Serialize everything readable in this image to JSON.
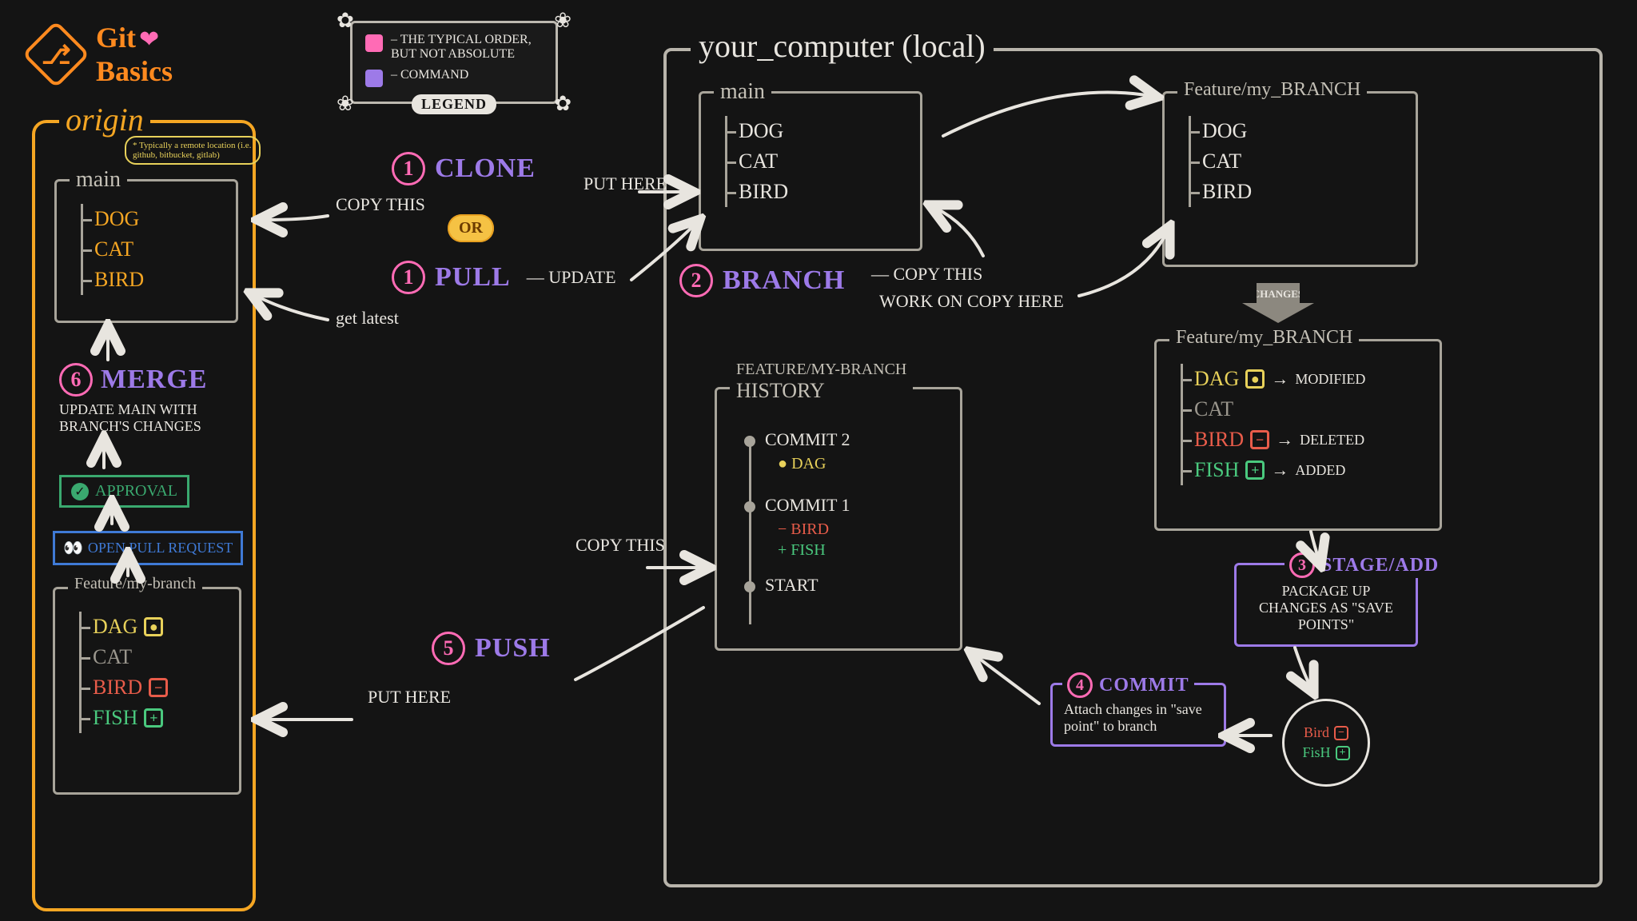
{
  "title": {
    "line1": "Git",
    "line2": "Basics"
  },
  "legend": {
    "label": "LEGEND",
    "pink_desc": "– THE TYPICAL ORDER, BUT NOT ABSOLUTE",
    "purple_desc": "– COMMAND"
  },
  "origin": {
    "title": "origin",
    "note": "* Typically a remote location (i.e. github, bitbucket, gitlab)",
    "main": {
      "title": "main",
      "files": [
        "DOG",
        "CAT",
        "BIRD"
      ]
    },
    "merge": {
      "num": "6",
      "cmd": "MERGE",
      "desc": "UPDATE MAIN WITH BRANCH'S CHANGES"
    },
    "approval": "APPROVAL",
    "pr": "OPEN PULL REQUEST",
    "feature": {
      "title": "Feature/my-branch",
      "files": [
        {
          "name": "DAG",
          "status": "modified"
        },
        {
          "name": "CAT",
          "status": "none"
        },
        {
          "name": "BIRD",
          "status": "deleted"
        },
        {
          "name": "FISH",
          "status": "added"
        }
      ]
    }
  },
  "local": {
    "title": "your_computer (local)",
    "main": {
      "title": "main",
      "files": [
        "DOG",
        "CAT",
        "BIRD"
      ]
    },
    "feature_clean": {
      "title": "Feature/my_BRANCH",
      "files": [
        "DOG",
        "CAT",
        "BIRD"
      ]
    },
    "changes_label": "CHANGES",
    "feature_changed": {
      "title": "Feature/my_BRANCH",
      "files": [
        {
          "name": "DAG",
          "status": "modified",
          "label": "MODIFIED"
        },
        {
          "name": "CAT",
          "status": "none",
          "label": ""
        },
        {
          "name": "BIRD",
          "status": "deleted",
          "label": "DELETED"
        },
        {
          "name": "FISH",
          "status": "added",
          "label": "ADDED"
        }
      ]
    },
    "history": {
      "title": "FEATURE/MY-BRANCH",
      "subtitle": "HISTORY",
      "commits": [
        {
          "label": "COMMIT 2",
          "changes": [
            {
              "sym": "●",
              "text": "DAG",
              "cls": "c-yellow"
            }
          ]
        },
        {
          "label": "COMMIT 1",
          "changes": [
            {
              "sym": "−",
              "text": "BIRD",
              "cls": "c-red"
            },
            {
              "sym": "+",
              "text": "FISH",
              "cls": "c-green"
            }
          ]
        },
        {
          "label": "START",
          "changes": []
        }
      ]
    },
    "stage": {
      "num": "3",
      "cmd": "STAGE/ADD",
      "desc": "PACKAGE UP CHANGES AS \"SAVE POINTS\""
    },
    "commit": {
      "num": "4",
      "cmd": "COMMIT",
      "desc": "Attach changes in \"save point\" to branch"
    },
    "save_point": [
      {
        "name": "Bird",
        "status": "deleted"
      },
      {
        "name": "FisH",
        "status": "added"
      }
    ]
  },
  "steps": {
    "clone": {
      "num": "1",
      "cmd": "CLONE",
      "left": "COPY THIS",
      "right": "PUT HERE"
    },
    "or": "OR",
    "pull": {
      "num": "1",
      "cmd": "PULL",
      "right": "UPDATE",
      "below": "get latest"
    },
    "branch": {
      "num": "2",
      "cmd": "BRANCH",
      "a": "COPY THIS",
      "b": "WORK ON COPY HERE"
    },
    "push": {
      "num": "5",
      "cmd": "PUSH",
      "left": "PUT HERE",
      "right": "COPY THIS"
    }
  }
}
